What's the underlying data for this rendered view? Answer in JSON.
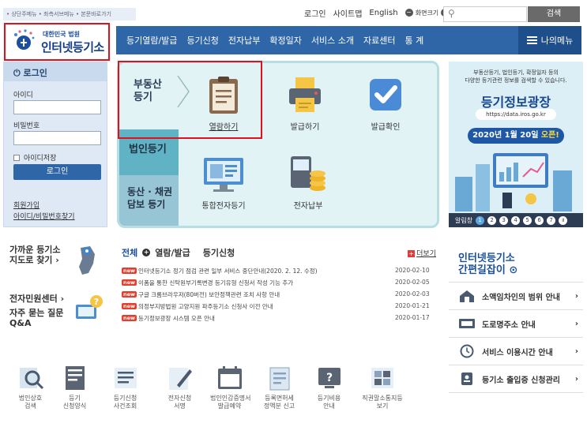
{
  "skip_links": "• 상단주메뉴 • 좌측서브메뉴 • 본문바로가기",
  "util": {
    "login": "로그인",
    "sitemap": "사이트맵",
    "english": "English",
    "zoom_out": "화면크기",
    "search_label": "검색"
  },
  "logo": {
    "small": "대한민국 법원",
    "big": "인터넷등기소"
  },
  "gnb": {
    "items": [
      "등기열람/발급",
      "등기신청",
      "전자납부",
      "확정일자",
      "서비스 소개",
      "자료센터",
      "통 계"
    ],
    "mymenu": "나의메뉴"
  },
  "login": {
    "title": "로그인",
    "id_label": "아이디",
    "pw_label": "비밀번호",
    "save_id": "아이디저장",
    "button": "로그인",
    "join": "회원가입",
    "find": "아이디/비밀번호찾기"
  },
  "service": {
    "real_estate": "부동산\n등기",
    "corp": "법인등기",
    "movable": "동산 · 채권\n담보 등기",
    "tiles": {
      "view": "열람하기",
      "issue": "발급하기",
      "confirm": "발급확인",
      "e_apply": "통합전자등기",
      "e_pay": "전자납부"
    }
  },
  "banner": {
    "line1": "부동산등기, 법인등기, 확정일자 등의",
    "line2": "다양한 등기관련 정보를 검색할 수 있습니다.",
    "title": "등기정보광장",
    "url": "https://data.iros.go.kr",
    "date_prefix": "2020년 1월 20일",
    "date_open": "오픈!",
    "foot_label": "알림창",
    "pages": [
      "1",
      "2",
      "3",
      "4",
      "5",
      "6",
      "7"
    ]
  },
  "lower_left": {
    "office1": "가까운 등기소",
    "office2": "지도로 찾기",
    "center": "전자민원센터",
    "faq1": "자주 묻는 질문",
    "faq2": "Q&A"
  },
  "notice": {
    "tabs": [
      "전체",
      "열람/발급",
      "등기신청"
    ],
    "more": "더보기",
    "new_label": "new",
    "items": [
      {
        "text": "인터넷등기소 정기 점검 관련 일부 서비스 중단안내(2020. 2. 12. 수정)",
        "date": "2020-02-10"
      },
      {
        "text": "이폼을 통한 신탁원부기록변경 등기유형 신청서 작성 기능 추가",
        "date": "2020-02-05"
      },
      {
        "text": "구글 크롬브라우저(80버전) 보안정책관련 조치 사항 안내",
        "date": "2020-02-03"
      },
      {
        "text": "의정부지방법원 고양지원 파주등기소 신청사 이전 안내",
        "date": "2020-01-21"
      },
      {
        "text": "등기정보광장 시스템 오픈 안내",
        "date": "2020-01-17"
      }
    ]
  },
  "quick": {
    "guide1": "인터넷등기소",
    "guide2": "간편길잡이",
    "rows": [
      "소액임차인의 범위 안내",
      "도로명주소 안내",
      "서비스 이용시간 안내",
      "등기소 출입증 신청관리"
    ]
  },
  "bottom_icons": [
    "법인상호\n검색",
    "등기\n신청양식",
    "등기신청\n사건조회",
    "전자신청\n서명",
    "법인인감증명서\n발급예약",
    "등록면허세\n정액분 신고",
    "등기비용\n안내",
    "직권말소통지등\n보기"
  ],
  "colors": {
    "nav_blue": "#2f66a8",
    "highlight_red": "#e0101e",
    "service_bg": "#e1f3f5"
  }
}
